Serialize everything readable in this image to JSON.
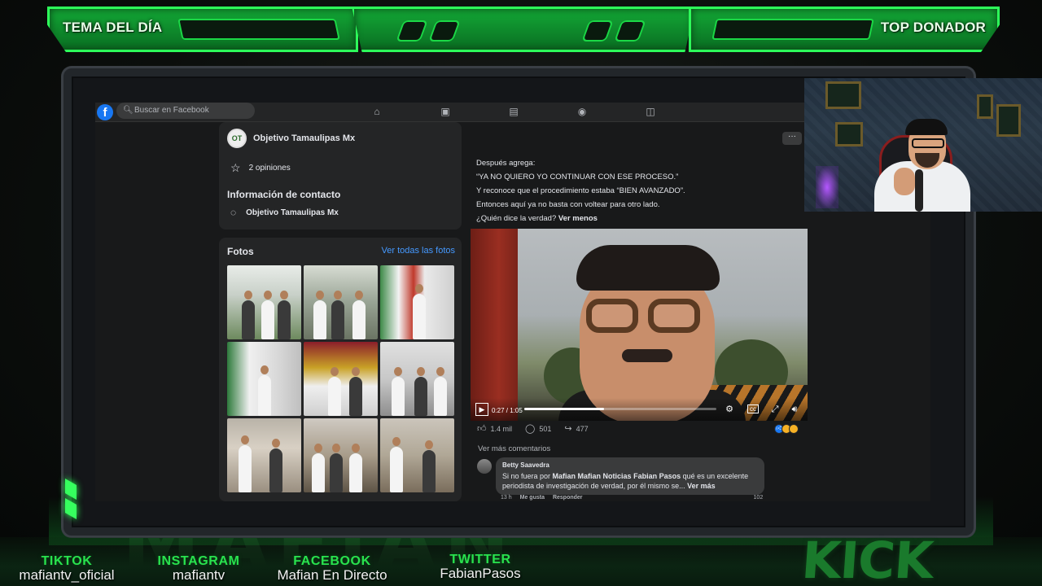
{
  "overlay": {
    "left_banner": "TEMA DEL DÍA",
    "right_banner": "TOP DONADOR",
    "kick_logo": "KICK",
    "accent_color": "#2dff5a"
  },
  "facebook": {
    "logo": "f",
    "search_placeholder": "Buscar en Facebook",
    "nav_icons": [
      "home-icon",
      "video-icon",
      "marketplace-icon",
      "groups-icon",
      "gaming-icon"
    ],
    "page": {
      "name": "Objetivo Tamaulipas Mx",
      "reviews": "2 opiniones",
      "contact_heading": "Información de contacto",
      "contact_messenger": "Objetivo Tamaulipas Mx"
    },
    "photos": {
      "title": "Fotos",
      "see_all": "Ver todas las fotos"
    },
    "post": {
      "more": "···",
      "lines": [
        "Después agrega:",
        "“YA NO QUIERO YO CONTINUAR CON ESE PROCESO.”",
        "Y reconoce que el procedimiento estaba “BIEN AVANZADO”.",
        "Entonces aquí ya no basta con voltear para otro lado."
      ],
      "last_line": "¿Quién dice la verdad?",
      "see_less": "Ver menos"
    },
    "video": {
      "time": "0:27 / 1:05",
      "progress": 0.415
    },
    "reactions": {
      "likes": "1.4 mil",
      "comments": "501",
      "shares": "477"
    },
    "comments": {
      "see_more": "Ver más comentarios",
      "items": [
        {
          "author": "Betty Saavedra",
          "text_before": "Si no fuera por ",
          "mention": "Mafian Mafian Noticias Fabian Pasos",
          "text_after": " qué es un excelente periodista de investigación de verdad, por él mismo se...",
          "see_more": "Ver más",
          "time": "13 h",
          "like": "Me gusta",
          "reply": "Responder",
          "count": "102"
        }
      ]
    }
  },
  "socials": [
    {
      "network": "TIKTOK",
      "handle": "mafiantv_oficial"
    },
    {
      "network": "INSTAGRAM",
      "handle": "mafiantv"
    },
    {
      "network": "FACEBOOK",
      "handle": "Mafian En Directo"
    },
    {
      "network": "TWITTER",
      "handle": "FabianPasos"
    }
  ]
}
